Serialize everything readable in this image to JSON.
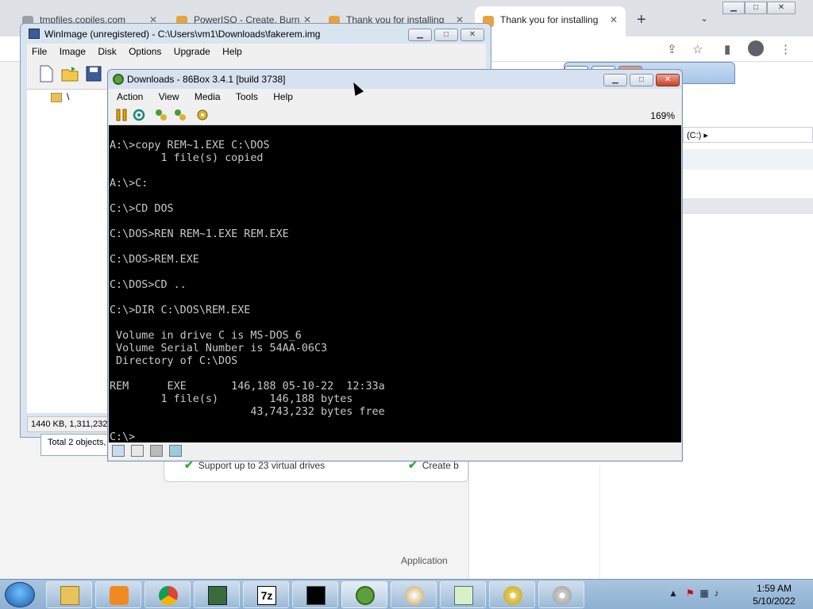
{
  "chrome": {
    "tabs": [
      {
        "title": "tmpfiles.copiles.com"
      },
      {
        "title": "PowerISO - Create, Burn"
      },
      {
        "title": "Thank you for installing"
      },
      {
        "title": "Thank you for installing"
      }
    ],
    "new_tab": "+",
    "features": [
      {
        "text": "Support up to 23 virtual drives"
      },
      {
        "text": "Create b"
      }
    ],
    "app_label": "Application"
  },
  "explorer": {
    "path_text": "(C:)"
  },
  "winimage": {
    "title": "WinImage (unregistered) - C:\\Users\\vm1\\Downloads\\fakerem.img",
    "menu": [
      "File",
      "Image",
      "Disk",
      "Options",
      "Upgrade",
      "Help"
    ],
    "tree_root": "\\",
    "status": "1440 KB, 1,311,232"
  },
  "poweriso_status": "Total 2 objects, 1",
  "box86": {
    "title": "Downloads - 86Box 3.4.1 [build 3738]",
    "menu": [
      "Action",
      "View",
      "Media",
      "Tools",
      "Help"
    ],
    "zoom": "169%",
    "screen_text": "A:\\>copy REM~1.EXE C:\\DOS\n        1 file(s) copied\n\nA:\\>C:\n\nC:\\>CD DOS\n\nC:\\DOS>REN REM~1.EXE REM.EXE\n\nC:\\DOS>REM.EXE\n\nC:\\DOS>CD ..\n\nC:\\>DIR C:\\DOS\\REM.EXE\n\n Volume in drive C is MS-DOS_6\n Volume Serial Number is 54AA-06C3\n Directory of C:\\DOS\n\nREM      EXE       146,188 05-10-22  12:33a\n        1 file(s)        146,188 bytes\n                      43,743,232 bytes free\n\nC:\\>"
  },
  "taskbar": {
    "apps": [
      "explorer-icon",
      "media-player-icon",
      "chrome-icon",
      "winimage-icon",
      "7zip-icon",
      "cmd-icon",
      "86box-icon",
      "paint-icon",
      "notepad-icon",
      "poweriso-icon",
      "disc-icon"
    ],
    "seven_zip_label": "7z",
    "time": "1:59 AM",
    "date": "5/10/2022"
  }
}
